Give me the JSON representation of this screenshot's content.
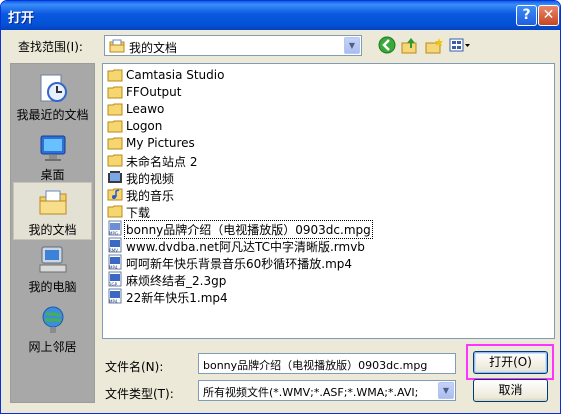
{
  "window": {
    "title": "打开",
    "help": "?",
    "close": "✕"
  },
  "lookin": {
    "label": "查找范围(I):",
    "value": "我的文档"
  },
  "places": [
    {
      "label": "我最近的文档",
      "icon": "recent-documents-icon"
    },
    {
      "label": "桌面",
      "icon": "desktop-icon"
    },
    {
      "label": "我的文档",
      "icon": "my-documents-icon"
    },
    {
      "label": "我的电脑",
      "icon": "my-computer-icon"
    },
    {
      "label": "网上邻居",
      "icon": "network-places-icon"
    }
  ],
  "files": [
    {
      "name": "Camtasia Studio",
      "icon": "folder-icon"
    },
    {
      "name": "FFOutput",
      "icon": "folder-icon"
    },
    {
      "name": "Leawo",
      "icon": "folder-icon"
    },
    {
      "name": "Logon",
      "icon": "folder-icon"
    },
    {
      "name": "My Pictures",
      "icon": "folder-icon"
    },
    {
      "name": "未命名站点 2",
      "icon": "folder-icon"
    },
    {
      "name": "我的视频",
      "icon": "video-folder-icon"
    },
    {
      "name": "我的音乐",
      "icon": "music-folder-icon"
    },
    {
      "name": "下载",
      "icon": "folder-icon"
    },
    {
      "name": "bonny品牌介绍（电视播放版）0903dc.mpg",
      "icon": "mpg-file-icon"
    },
    {
      "name": "www.dvdba.net阿凡达TC中字清晰版.rmvb",
      "icon": "rmvb-file-icon"
    },
    {
      "name": "呵呵新年快乐背景音乐60秒循环播放.mp4",
      "icon": "mp4-file-icon"
    },
    {
      "name": "麻烦终结者_2.3gp",
      "icon": "3gp-file-icon"
    },
    {
      "name": "22新年快乐1.mp4",
      "icon": "mp4-file-icon"
    }
  ],
  "filename": {
    "label": "文件名(N):",
    "value": "bonny品牌介绍（电视播放版）0903dc.mpg"
  },
  "filetype": {
    "label": "文件类型(T):",
    "value": "所有视频文件(*.WMV;*.ASF;*.WMA;*.AVI;"
  },
  "buttons": {
    "open": "打开(O)",
    "cancel": "取消"
  },
  "colors": {
    "title_bar": "#0a58e0",
    "selection": "#316ac5",
    "highlight_box": "#ff33ff"
  }
}
